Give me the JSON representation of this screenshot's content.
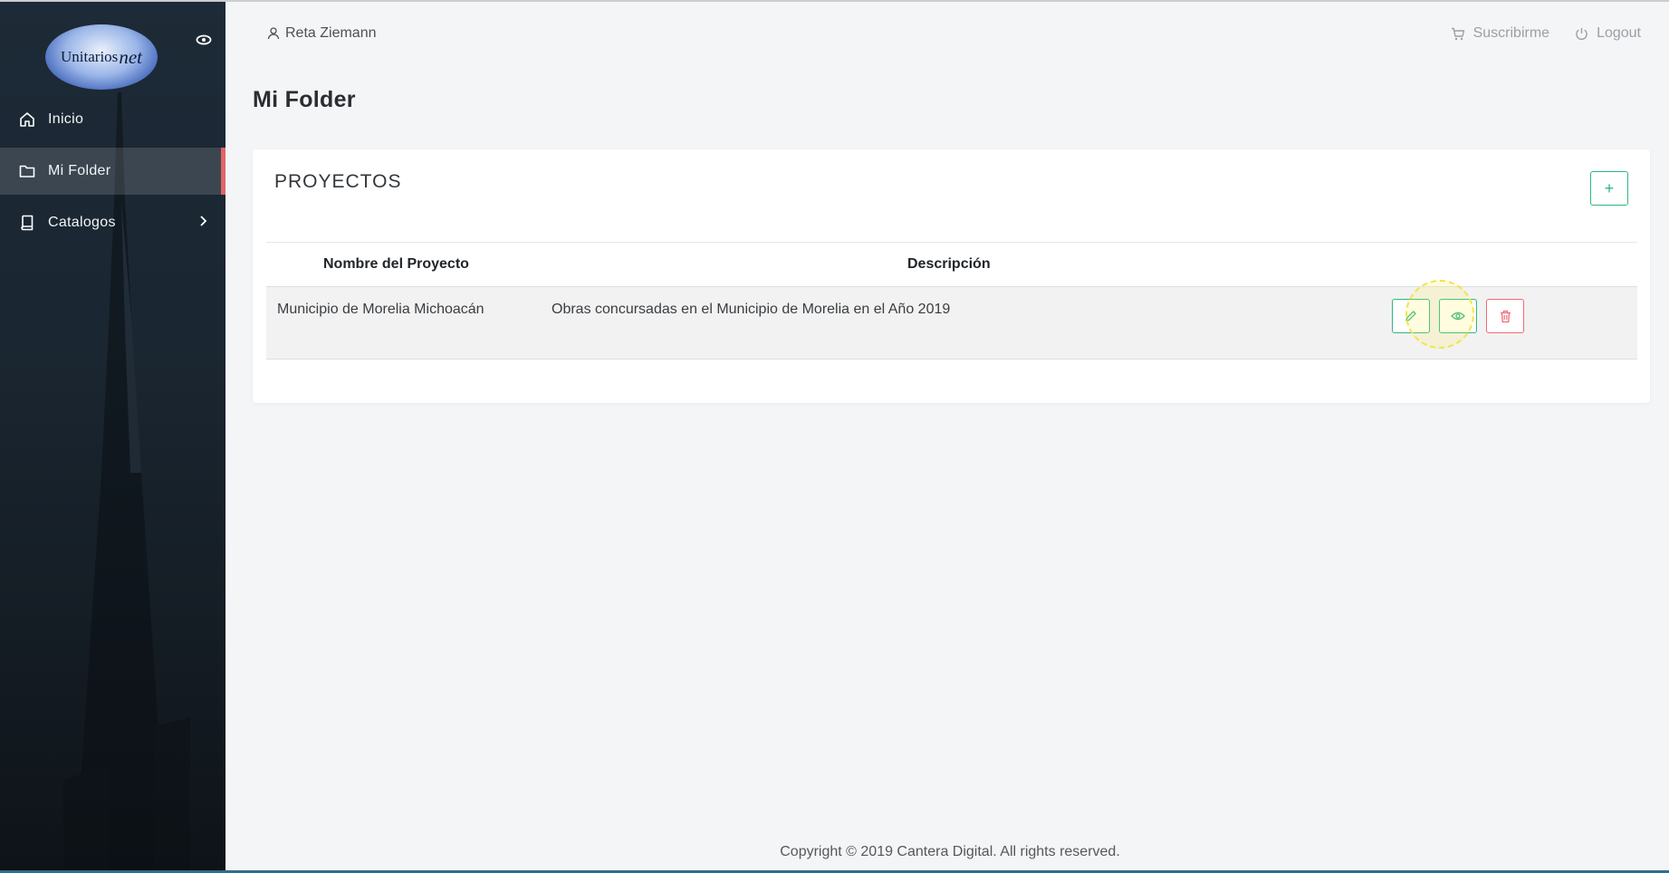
{
  "sidebar": {
    "logo_text": "Unitarios",
    "logo_suffix": "net",
    "items": [
      {
        "label": "Inicio",
        "icon": "home-icon"
      },
      {
        "label": "Mi Folder",
        "icon": "folder-icon",
        "active": true
      },
      {
        "label": "Catalogos",
        "icon": "book-icon",
        "has_submenu": true
      }
    ]
  },
  "header": {
    "user_name": "Reta Ziemann",
    "subscribe_label": "Suscribirme",
    "logout_label": "Logout"
  },
  "page": {
    "title": "Mi Folder"
  },
  "card": {
    "title": "PROYECTOS",
    "add_button_label": "+"
  },
  "table": {
    "columns": [
      "Nombre del Proyecto",
      "Descripción"
    ],
    "rows": [
      {
        "name": "Municipio de Morelia Michoacán",
        "description": "Obras concursadas en el Municipio de Morelia en el Año 2019"
      }
    ]
  },
  "footer": {
    "copyright": "Copyright © 2019 Cantera Digital. All rights reserved."
  },
  "colors": {
    "accent_green": "#2eb87e",
    "accent_red": "#ee6b76",
    "active_marker": "#e06468",
    "sidebar_bg": "#1a2631"
  }
}
